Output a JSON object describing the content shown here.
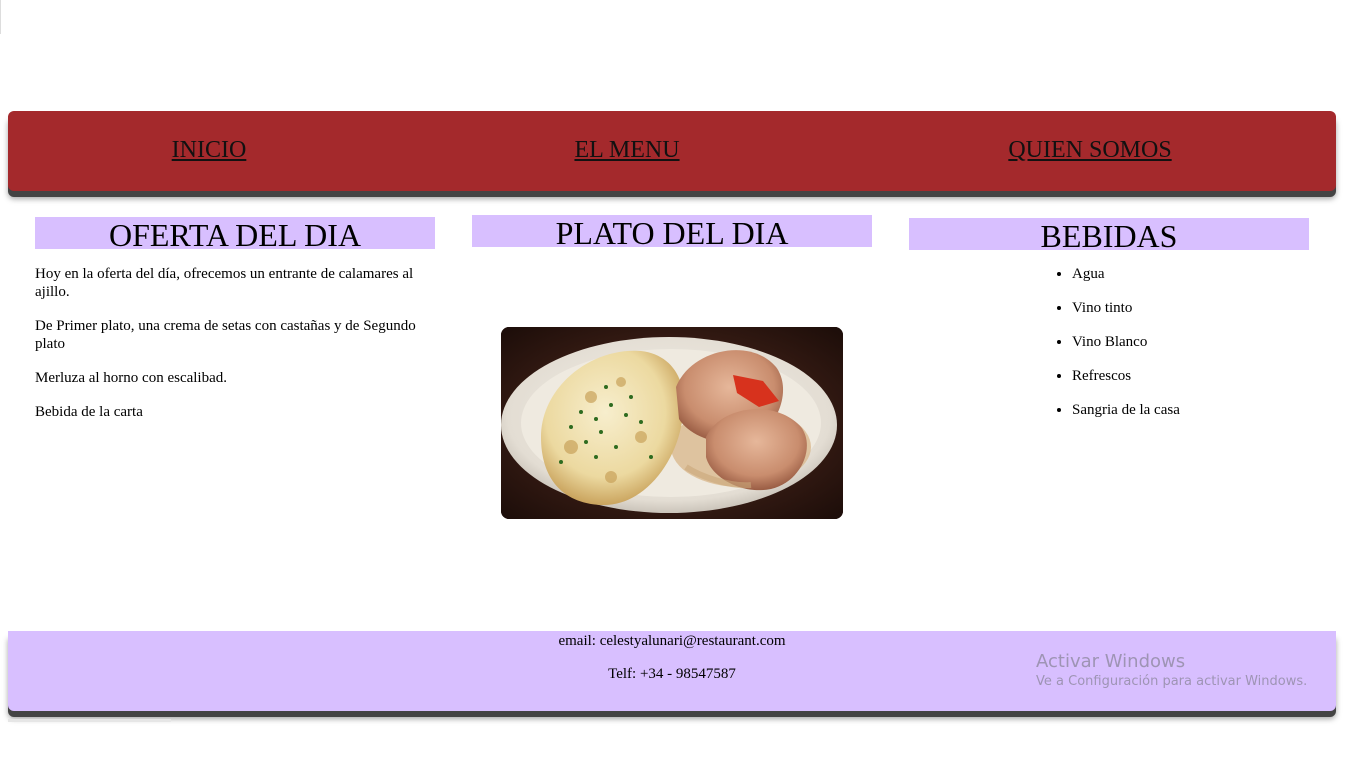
{
  "nav": {
    "items": [
      {
        "label": "INICIO"
      },
      {
        "label": "EL MENU"
      },
      {
        "label": "QUIEN SOMOS"
      }
    ],
    "background": "#a4292c"
  },
  "oferta": {
    "title": "OFERTA DEL DIA",
    "paragraphs": [
      "Hoy en la oferta del día, ofrecemos un entrante de calamares al ajillo.",
      "De Primer plato, una crema de setas con castañas y de Segundo plato",
      "Merluza al horno con escalibad.",
      "Bebida de la carta"
    ]
  },
  "plato": {
    "title": "PLATO DEL DIA"
  },
  "bebidas": {
    "title": "BEBIDAS",
    "items": [
      "Agua",
      "Vino tinto",
      "Vino Blanco",
      "Refrescos",
      "Sangria de la casa"
    ]
  },
  "footer": {
    "email": "email: celestyalunari@restaurant.com",
    "phone": "Telf: +34 - 98547587",
    "background": "#d8bfff"
  },
  "watermark": {
    "line1": "Activar Windows",
    "line2": "Ve a Configuración para activar Windows."
  }
}
